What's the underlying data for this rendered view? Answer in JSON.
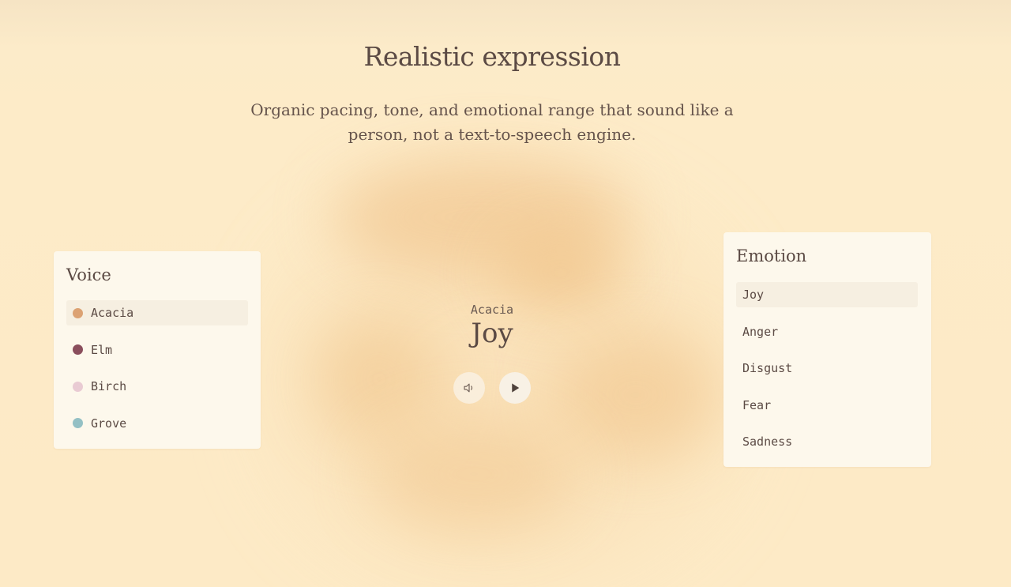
{
  "hero": {
    "title": "Realistic expression",
    "subtitle": "Organic pacing, tone, and emotional range that sound like a person, not a text-to-speech engine."
  },
  "voice_panel": {
    "title": "Voice",
    "selected": "Acacia",
    "items": [
      {
        "label": "Acacia",
        "color": "#dca273"
      },
      {
        "label": "Elm",
        "color": "#8a4e5c"
      },
      {
        "label": "Birch",
        "color": "#e9cbd3"
      },
      {
        "label": "Grove",
        "color": "#94c0c4"
      }
    ]
  },
  "emotion_panel": {
    "title": "Emotion",
    "selected": "Joy",
    "items": [
      {
        "label": "Joy"
      },
      {
        "label": "Anger"
      },
      {
        "label": "Disgust"
      },
      {
        "label": "Fear"
      },
      {
        "label": "Sadness"
      }
    ]
  },
  "player": {
    "voice": "Acacia",
    "emotion": "Joy",
    "volume_icon": "volume-icon",
    "play_icon": "play-icon"
  },
  "colors": {
    "background": "#fdebc8",
    "panel": "#fdf8ec",
    "selected_item": "#f6efe1",
    "text": "#5b4a44"
  }
}
